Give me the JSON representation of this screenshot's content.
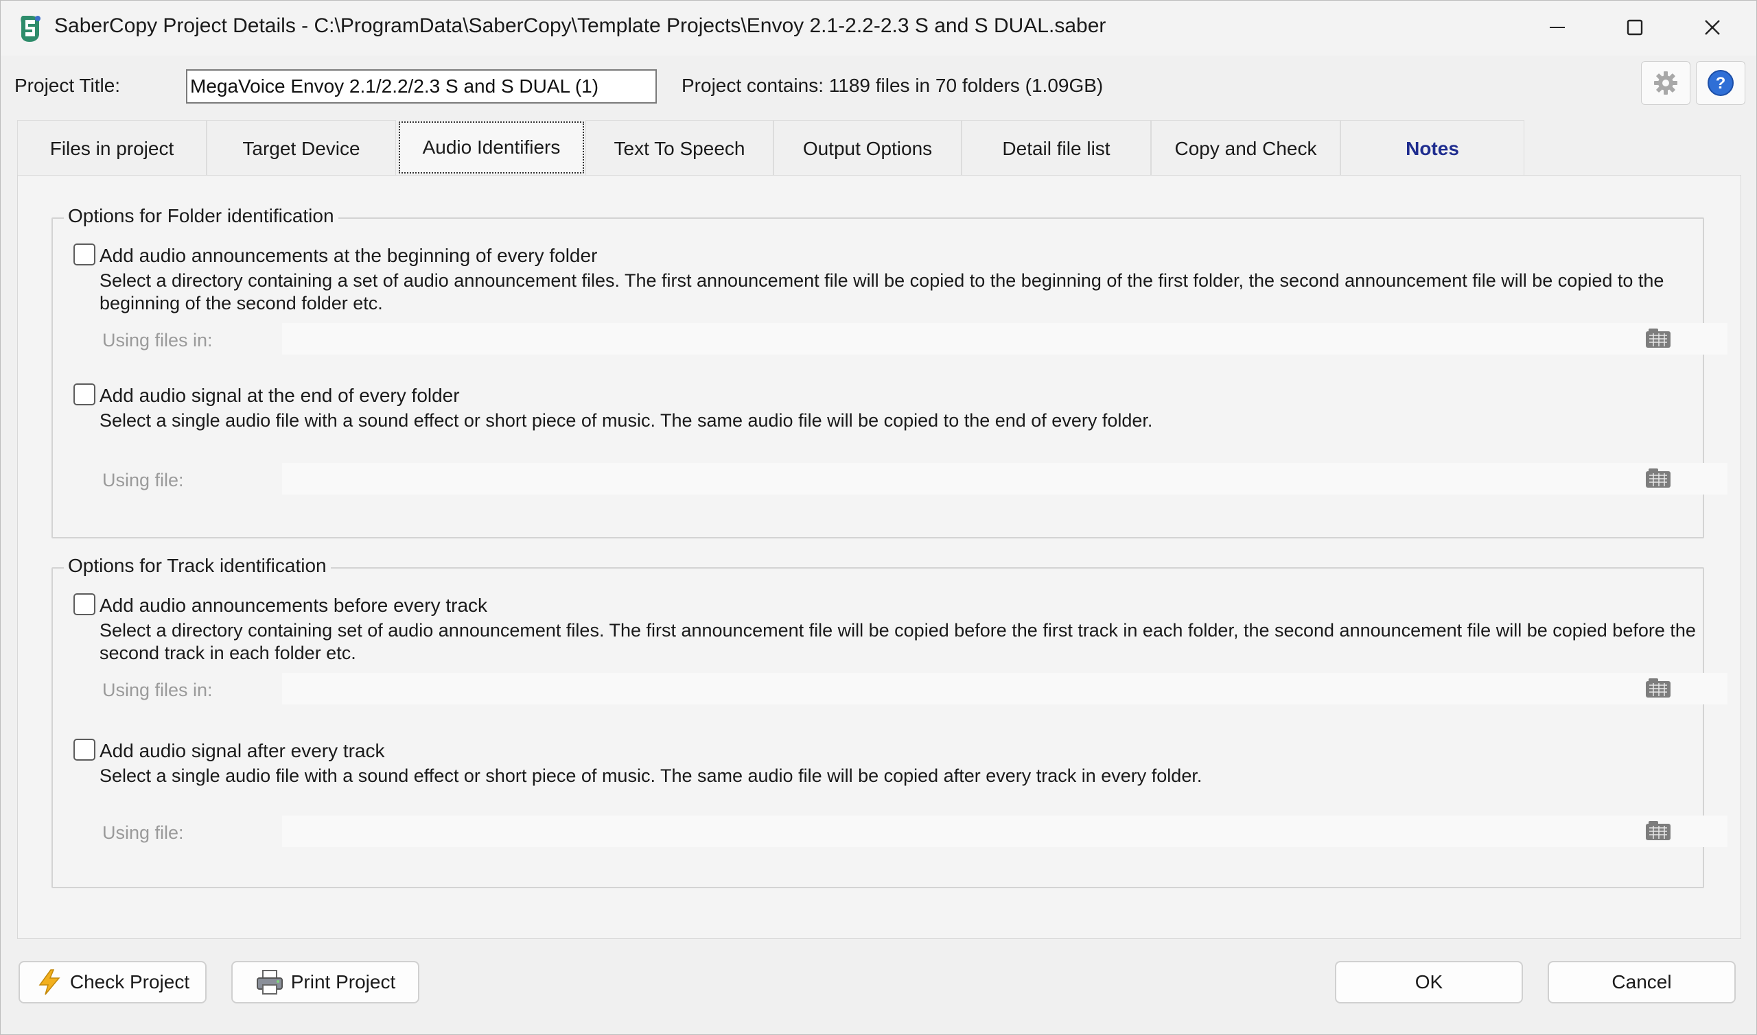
{
  "window": {
    "title": "SaberCopy Project Details - C:\\ProgramData\\SaberCopy\\Template Projects\\Envoy 2.1-2.2-2.3 S and S DUAL.saber",
    "icon": "sabercopy-app-icon",
    "controls": {
      "minimize": "minimize-icon",
      "maximize": "maximize-icon",
      "close": "close-icon"
    }
  },
  "project": {
    "title_label": "Project Title:",
    "title_value": "MegaVoice Envoy 2.1/2.2/2.3 S and S DUAL (1)",
    "contains_text": "Project contains: 1189 files in 70 folders (1.09GB)"
  },
  "toolbar": {
    "settings_icon": "gear-icon",
    "help_icon": "help-icon"
  },
  "tabs": [
    {
      "label": "Files in project"
    },
    {
      "label": "Target Device"
    },
    {
      "label": "Audio Identifiers",
      "active": true
    },
    {
      "label": "Text To Speech"
    },
    {
      "label": "Output Options"
    },
    {
      "label": "Detail file list"
    },
    {
      "label": "Copy and Check"
    },
    {
      "label": "Notes"
    }
  ],
  "folder_group": {
    "legend": "Options for Folder identification",
    "announce": {
      "checked": false,
      "title": "Add audio announcements at the beginning of every folder",
      "description": "Select a directory containing a set of audio announcement files. The first announcement file will be copied to the beginning of the first folder, the second announcement file will be copied to the beginning of the second folder etc.",
      "using_label": "Using files in:",
      "value": ""
    },
    "signal": {
      "checked": false,
      "title": "Add audio signal at the end of every folder",
      "description": "Select a single audio file with a sound effect or short piece of music. The same audio file will be copied to the end of every folder.",
      "using_label": "Using file:",
      "value": ""
    }
  },
  "track_group": {
    "legend": "Options for Track identification",
    "announce": {
      "checked": false,
      "title": "Add audio announcements before every track",
      "description": "Select a directory containing set of audio announcement files. The first announcement file will be copied before the first track in each folder, the second announcement file will be copied before the second track in each folder etc.",
      "using_label": "Using files in:",
      "value": ""
    },
    "signal": {
      "checked": false,
      "title": "Add audio signal after every track",
      "description": "Select a single audio file with a sound effect or short piece of music. The same audio file will be copied after every track in every folder.",
      "using_label": "Using file:",
      "value": ""
    }
  },
  "buttons": {
    "check_project": "Check Project",
    "print_project": "Print Project",
    "ok": "OK",
    "cancel": "Cancel"
  },
  "colors": {
    "notes_tab": "#1f2d8f",
    "help_button": "#2f6fd6",
    "check_icon": "#f2b01e"
  }
}
